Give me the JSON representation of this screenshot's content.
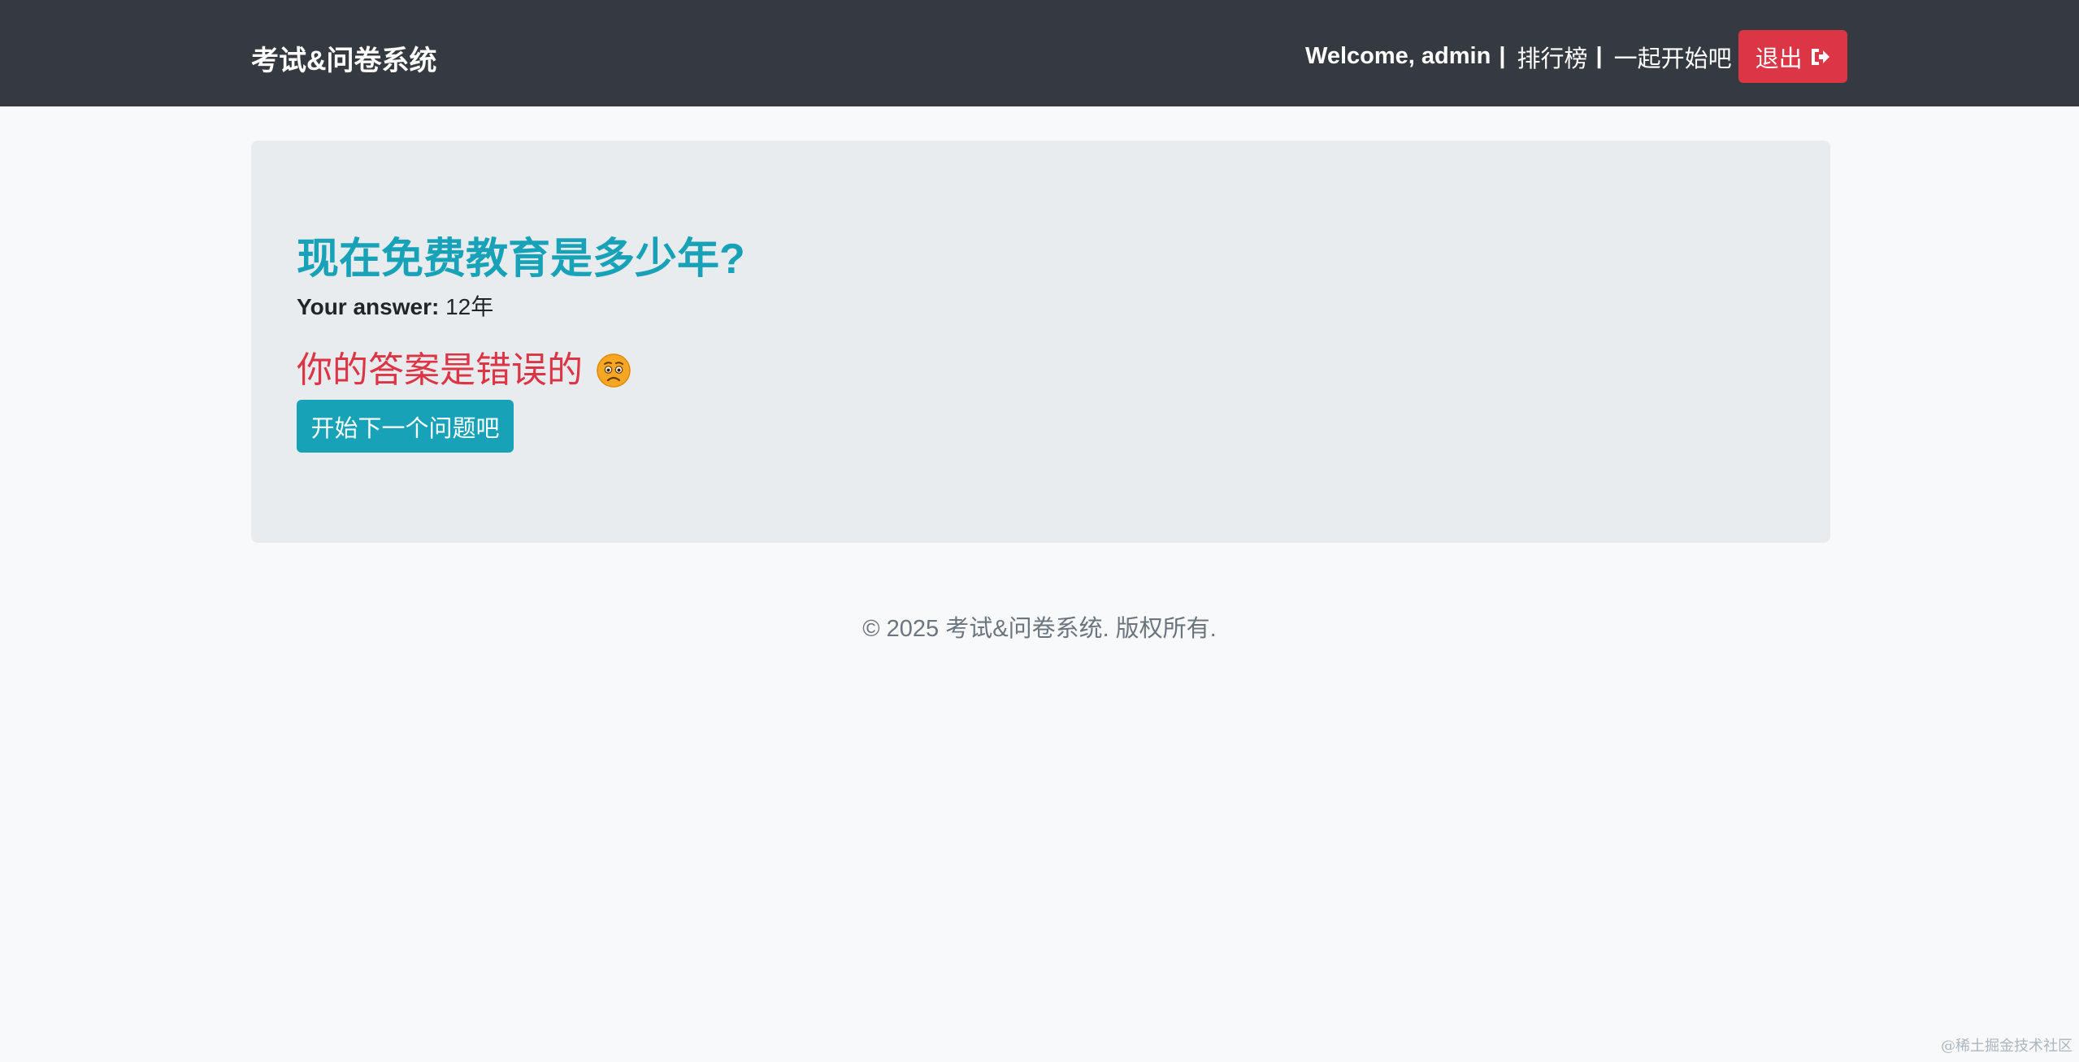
{
  "navbar": {
    "brand": "考试&问卷系统",
    "welcome": "Welcome, admin",
    "separator": "|",
    "leaderboard_link": "排行榜",
    "start_link": "一起开始吧",
    "logout_label": "退出",
    "logout_icon": "sign-out-icon"
  },
  "main": {
    "question": "现在免费教育是多少年?",
    "answer_label": "Your answer:",
    "answer_value": "12年",
    "result_text": "你的答案是错误的",
    "result_icon": "worried-face-emoji",
    "next_button": "开始下一个问题吧"
  },
  "footer": {
    "copyright": "© 2025 考试&问卷系统.  版权所有."
  },
  "watermark": "@稀土掘金技术社区",
  "colors": {
    "navbar_bg": "#343a40",
    "page_bg": "#f8f9fa",
    "panel_bg": "#e9ecef",
    "question": "#17a2b8",
    "wrong": "#dc3545",
    "logout_button": "#dc3545",
    "next_button": "#17a2b8"
  }
}
